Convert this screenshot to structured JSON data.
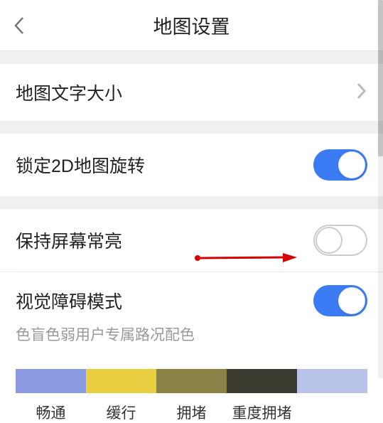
{
  "header": {
    "title": "地图设置"
  },
  "rows": {
    "text_size": {
      "label": "地图文字大小"
    },
    "lock_2d": {
      "label": "锁定2D地图旋转",
      "on": true
    },
    "keep_awake": {
      "label": "保持屏幕常亮",
      "on": false
    },
    "vis_mode": {
      "label": "视觉障碍模式",
      "on": true,
      "subtitle": "色盲色弱用户专属路况配色"
    }
  },
  "legend": {
    "colors": [
      "#8c9ae3",
      "#e7cf3f",
      "#8a8146",
      "#3b3a2f",
      "#b9c2e8"
    ],
    "labels": [
      "畅通",
      "缓行",
      "拥堵",
      "重度拥堵",
      ""
    ]
  }
}
